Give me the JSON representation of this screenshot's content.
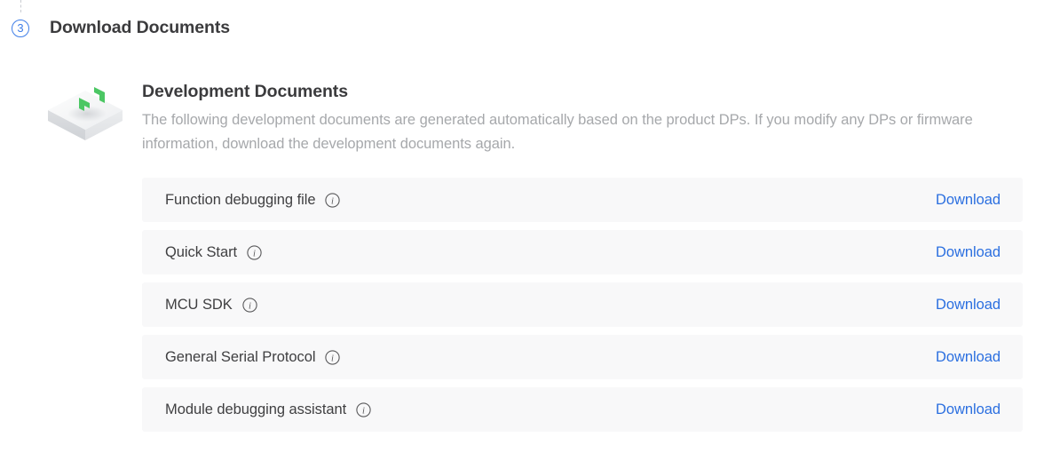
{
  "step": {
    "number": "3",
    "title": "Download Documents"
  },
  "section": {
    "icon_name": "isometric-code-box-icon",
    "title": "Development Documents",
    "description": "The following development documents are generated automatically based on the product DPs. If you modify any DPs or firmware information, download the development documents again."
  },
  "documents": [
    {
      "label": "Function debugging file",
      "info_icon": "info-circle-icon",
      "action": "Download"
    },
    {
      "label": "Quick Start",
      "info_icon": "info-circle-icon",
      "action": "Download"
    },
    {
      "label": "MCU SDK",
      "info_icon": "info-circle-icon",
      "action": "Download"
    },
    {
      "label": "General Serial Protocol",
      "info_icon": "info-circle-icon",
      "action": "Download"
    },
    {
      "label": "Module debugging assistant",
      "info_icon": "info-circle-icon",
      "action": "Download"
    }
  ],
  "colors": {
    "accent_blue": "#2b6fe0",
    "badge_blue": "#3f7ee8",
    "row_background": "#f8f8f9",
    "title_text": "#3b3b3d",
    "description_text": "#a6a8ab",
    "icon_green": "#4cc764"
  }
}
